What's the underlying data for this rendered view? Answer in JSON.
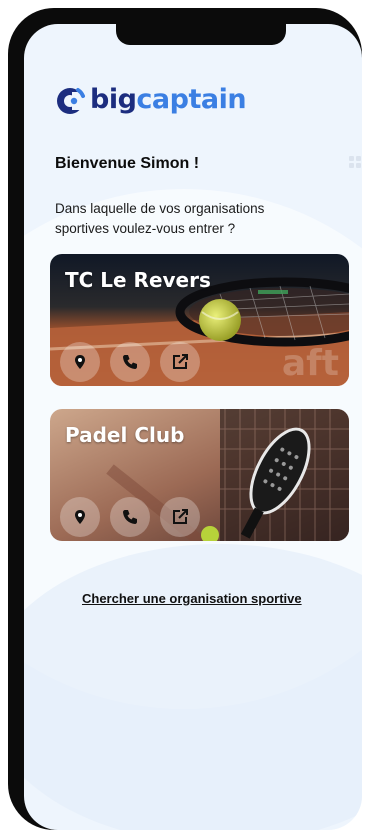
{
  "brand": {
    "name_part1": "big",
    "name_part2": "captain",
    "icon": "bigcaptain-logo-icon"
  },
  "header": {
    "welcome": "Bienvenue Simon !",
    "menu_icon": "grid-icon"
  },
  "prompt": {
    "question": "Dans laquelle de vos organisations sportives voulez-vous entrer ?"
  },
  "organizations": [
    {
      "name": "TC Le Revers",
      "sport": "tennis",
      "watermark": "aft",
      "actions": [
        {
          "icon": "location-pin-icon",
          "label": "location"
        },
        {
          "icon": "phone-icon",
          "label": "phone"
        },
        {
          "icon": "external-link-icon",
          "label": "website"
        }
      ]
    },
    {
      "name": "Padel Club",
      "sport": "padel",
      "actions": [
        {
          "icon": "location-pin-icon",
          "label": "location"
        },
        {
          "icon": "phone-icon",
          "label": "phone"
        },
        {
          "icon": "external-link-icon",
          "label": "website"
        }
      ]
    }
  ],
  "footer": {
    "search_link": "Chercher une organisation sportive"
  },
  "colors": {
    "brand_dark": "#1c2d7f",
    "brand_light": "#3b7fe3",
    "background": "#eef5fd",
    "frame": "#0b0b0b"
  }
}
